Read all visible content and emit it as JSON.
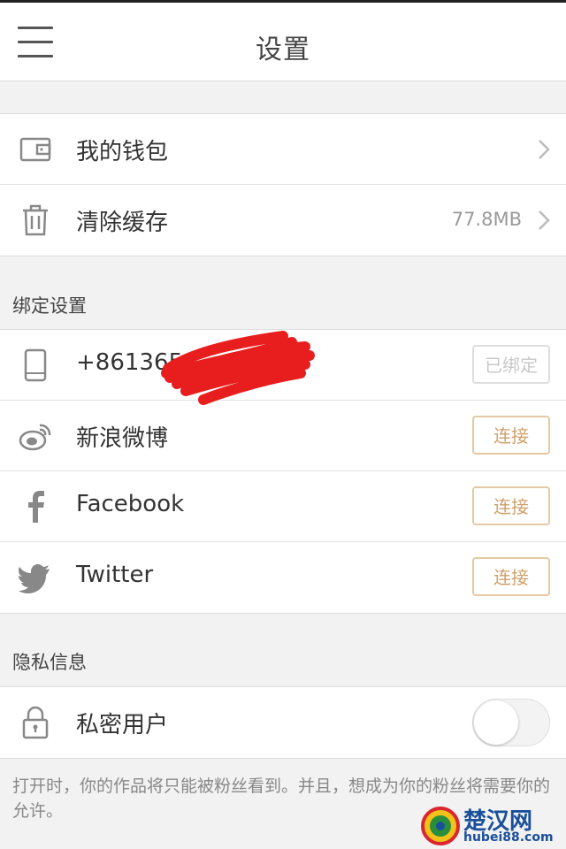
{
  "header": {
    "title": "设置",
    "menu_icon": "hamburger-menu-icon"
  },
  "general": [
    {
      "icon": "wallet-icon",
      "label": "我的钱包",
      "value": ""
    },
    {
      "icon": "trash-icon",
      "label": "清除缓存",
      "value": "77.8MB"
    }
  ],
  "binding": {
    "title": "绑定设置",
    "phone": {
      "icon": "phone-icon",
      "label": "+8613656",
      "button": "已绑定"
    },
    "weibo": {
      "icon": "weibo-icon",
      "label": "新浪微博",
      "button": "连接"
    },
    "facebook": {
      "icon": "facebook-icon",
      "label": "Facebook",
      "button": "连接"
    },
    "twitter": {
      "icon": "twitter-icon",
      "label": "Twitter",
      "button": "连接"
    }
  },
  "privacy": {
    "title": "隐私信息",
    "private_user": {
      "icon": "lock-icon",
      "label": "私密用户",
      "enabled": false
    },
    "note": "打开时，你的作品将只能被粉丝看到。并且，想成为你的粉丝将需要你的允许。"
  },
  "watermark": {
    "name": "楚汉网",
    "url": "hubei88.com"
  },
  "colors": {
    "connect": "#cfa06a",
    "redaction": "#e81e1e"
  }
}
